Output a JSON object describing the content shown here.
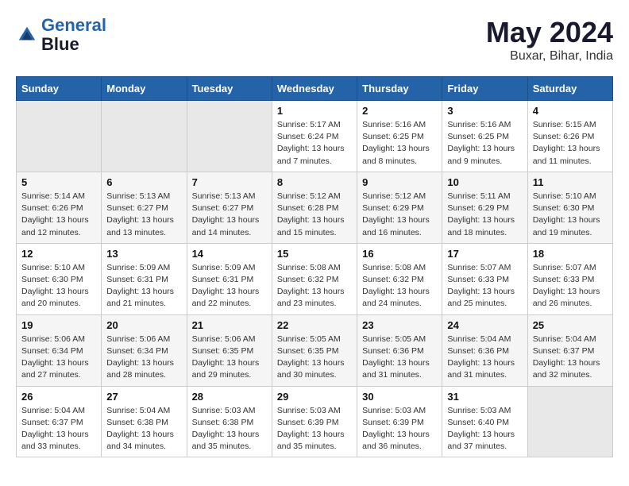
{
  "header": {
    "logo_line1": "General",
    "logo_line2": "Blue",
    "month": "May 2024",
    "location": "Buxar, Bihar, India"
  },
  "weekdays": [
    "Sunday",
    "Monday",
    "Tuesday",
    "Wednesday",
    "Thursday",
    "Friday",
    "Saturday"
  ],
  "weeks": [
    [
      {
        "day": "",
        "info": ""
      },
      {
        "day": "",
        "info": ""
      },
      {
        "day": "",
        "info": ""
      },
      {
        "day": "1",
        "info": "Sunrise: 5:17 AM\nSunset: 6:24 PM\nDaylight: 13 hours\nand 7 minutes."
      },
      {
        "day": "2",
        "info": "Sunrise: 5:16 AM\nSunset: 6:25 PM\nDaylight: 13 hours\nand 8 minutes."
      },
      {
        "day": "3",
        "info": "Sunrise: 5:16 AM\nSunset: 6:25 PM\nDaylight: 13 hours\nand 9 minutes."
      },
      {
        "day": "4",
        "info": "Sunrise: 5:15 AM\nSunset: 6:26 PM\nDaylight: 13 hours\nand 11 minutes."
      }
    ],
    [
      {
        "day": "5",
        "info": "Sunrise: 5:14 AM\nSunset: 6:26 PM\nDaylight: 13 hours\nand 12 minutes."
      },
      {
        "day": "6",
        "info": "Sunrise: 5:13 AM\nSunset: 6:27 PM\nDaylight: 13 hours\nand 13 minutes."
      },
      {
        "day": "7",
        "info": "Sunrise: 5:13 AM\nSunset: 6:27 PM\nDaylight: 13 hours\nand 14 minutes."
      },
      {
        "day": "8",
        "info": "Sunrise: 5:12 AM\nSunset: 6:28 PM\nDaylight: 13 hours\nand 15 minutes."
      },
      {
        "day": "9",
        "info": "Sunrise: 5:12 AM\nSunset: 6:29 PM\nDaylight: 13 hours\nand 16 minutes."
      },
      {
        "day": "10",
        "info": "Sunrise: 5:11 AM\nSunset: 6:29 PM\nDaylight: 13 hours\nand 18 minutes."
      },
      {
        "day": "11",
        "info": "Sunrise: 5:10 AM\nSunset: 6:30 PM\nDaylight: 13 hours\nand 19 minutes."
      }
    ],
    [
      {
        "day": "12",
        "info": "Sunrise: 5:10 AM\nSunset: 6:30 PM\nDaylight: 13 hours\nand 20 minutes."
      },
      {
        "day": "13",
        "info": "Sunrise: 5:09 AM\nSunset: 6:31 PM\nDaylight: 13 hours\nand 21 minutes."
      },
      {
        "day": "14",
        "info": "Sunrise: 5:09 AM\nSunset: 6:31 PM\nDaylight: 13 hours\nand 22 minutes."
      },
      {
        "day": "15",
        "info": "Sunrise: 5:08 AM\nSunset: 6:32 PM\nDaylight: 13 hours\nand 23 minutes."
      },
      {
        "day": "16",
        "info": "Sunrise: 5:08 AM\nSunset: 6:32 PM\nDaylight: 13 hours\nand 24 minutes."
      },
      {
        "day": "17",
        "info": "Sunrise: 5:07 AM\nSunset: 6:33 PM\nDaylight: 13 hours\nand 25 minutes."
      },
      {
        "day": "18",
        "info": "Sunrise: 5:07 AM\nSunset: 6:33 PM\nDaylight: 13 hours\nand 26 minutes."
      }
    ],
    [
      {
        "day": "19",
        "info": "Sunrise: 5:06 AM\nSunset: 6:34 PM\nDaylight: 13 hours\nand 27 minutes."
      },
      {
        "day": "20",
        "info": "Sunrise: 5:06 AM\nSunset: 6:34 PM\nDaylight: 13 hours\nand 28 minutes."
      },
      {
        "day": "21",
        "info": "Sunrise: 5:06 AM\nSunset: 6:35 PM\nDaylight: 13 hours\nand 29 minutes."
      },
      {
        "day": "22",
        "info": "Sunrise: 5:05 AM\nSunset: 6:35 PM\nDaylight: 13 hours\nand 30 minutes."
      },
      {
        "day": "23",
        "info": "Sunrise: 5:05 AM\nSunset: 6:36 PM\nDaylight: 13 hours\nand 31 minutes."
      },
      {
        "day": "24",
        "info": "Sunrise: 5:04 AM\nSunset: 6:36 PM\nDaylight: 13 hours\nand 31 minutes."
      },
      {
        "day": "25",
        "info": "Sunrise: 5:04 AM\nSunset: 6:37 PM\nDaylight: 13 hours\nand 32 minutes."
      }
    ],
    [
      {
        "day": "26",
        "info": "Sunrise: 5:04 AM\nSunset: 6:37 PM\nDaylight: 13 hours\nand 33 minutes."
      },
      {
        "day": "27",
        "info": "Sunrise: 5:04 AM\nSunset: 6:38 PM\nDaylight: 13 hours\nand 34 minutes."
      },
      {
        "day": "28",
        "info": "Sunrise: 5:03 AM\nSunset: 6:38 PM\nDaylight: 13 hours\nand 35 minutes."
      },
      {
        "day": "29",
        "info": "Sunrise: 5:03 AM\nSunset: 6:39 PM\nDaylight: 13 hours\nand 35 minutes."
      },
      {
        "day": "30",
        "info": "Sunrise: 5:03 AM\nSunset: 6:39 PM\nDaylight: 13 hours\nand 36 minutes."
      },
      {
        "day": "31",
        "info": "Sunrise: 5:03 AM\nSunset: 6:40 PM\nDaylight: 13 hours\nand 37 minutes."
      },
      {
        "day": "",
        "info": ""
      }
    ]
  ]
}
